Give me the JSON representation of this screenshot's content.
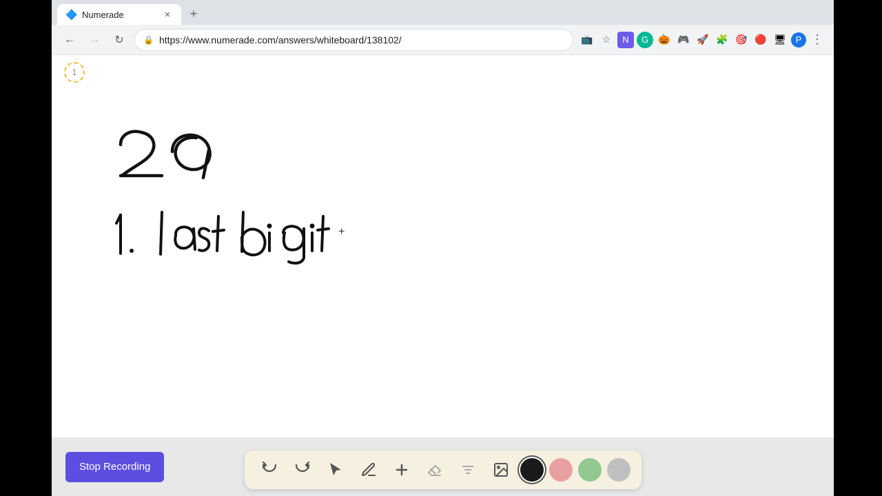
{
  "browser": {
    "tab": {
      "title": "Numerade",
      "favicon_color": "#6c5ce7",
      "url": "https://www.numerade.com/answers/whiteboard/138102/"
    },
    "new_tab_label": "+",
    "nav": {
      "back_enabled": true,
      "forward_enabled": false,
      "url": "https://www.numerade.com/answers/whiteboard/138102/"
    }
  },
  "page_indicator": "1",
  "whiteboard": {
    "content_number": "29",
    "content_step": "1.  last digit"
  },
  "toolbar": {
    "undo_label": "↺",
    "redo_label": "↻",
    "select_label": "select",
    "pen_label": "pen",
    "plus_label": "+",
    "eraser_label": "eraser",
    "text_label": "A",
    "image_label": "image",
    "colors": [
      {
        "name": "black",
        "hex": "#1a1a1a",
        "selected": true
      },
      {
        "name": "pink",
        "hex": "#e8a0a0"
      },
      {
        "name": "green",
        "hex": "#90c890"
      },
      {
        "name": "gray",
        "hex": "#c0c0c0"
      }
    ]
  },
  "stop_recording": {
    "label": "Stop Recording",
    "bg_color": "#5c4ee0"
  }
}
